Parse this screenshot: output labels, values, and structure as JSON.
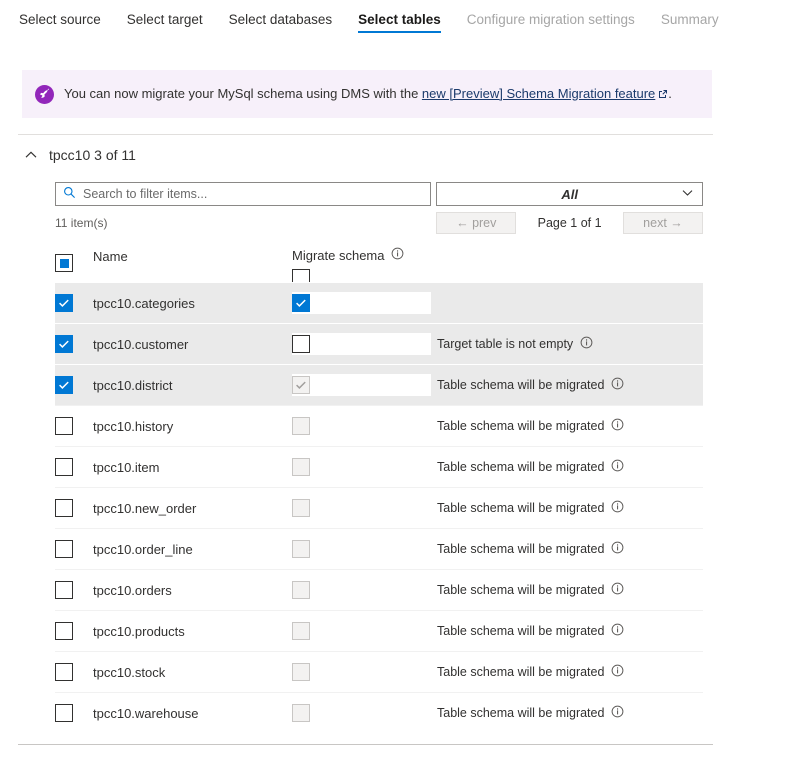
{
  "wizard": {
    "tabs": [
      {
        "label": "Select source",
        "state": "done"
      },
      {
        "label": "Select target",
        "state": "done"
      },
      {
        "label": "Select databases",
        "state": "done"
      },
      {
        "label": "Select tables",
        "state": "active"
      },
      {
        "label": "Configure migration settings",
        "state": "disabled"
      },
      {
        "label": "Summary",
        "state": "disabled"
      }
    ]
  },
  "banner": {
    "icon": "rocket-icon",
    "text_before": "You can now migrate your MySql schema using DMS with the ",
    "link_text": "new [Preview] Schema Migration feature",
    "text_after": ".",
    "background": "#f7f0fa",
    "icon_color": "#9226ba"
  },
  "section": {
    "expand_icon": "chevron-up-icon",
    "title": "tpcc10 3 of 11"
  },
  "toolbar": {
    "search": {
      "icon": "search-icon",
      "placeholder": "Search to filter items...",
      "value": ""
    },
    "filter": {
      "selected": "All",
      "icon": "chevron-down-icon"
    },
    "item_count": "11 item(s)",
    "prev_label": "← prev",
    "next_label": "next →",
    "page_label": "Page 1 of 1"
  },
  "table": {
    "header": {
      "select_all_state": "indeterminate",
      "name_label": "Name",
      "schema_label": "Migrate schema",
      "schema_info_icon": "info-icon",
      "schema_header_checkbox": "unchecked"
    },
    "rows": [
      {
        "name": "tpcc10.categories",
        "selected": true,
        "schema": "checked",
        "status": ""
      },
      {
        "name": "tpcc10.customer",
        "selected": true,
        "schema": "unchecked",
        "status": "Target table is not empty"
      },
      {
        "name": "tpcc10.district",
        "selected": true,
        "schema": "disabled-checked",
        "status": "Table schema will be migrated"
      },
      {
        "name": "tpcc10.history",
        "selected": false,
        "schema": "disabled-empty",
        "status": "Table schema will be migrated"
      },
      {
        "name": "tpcc10.item",
        "selected": false,
        "schema": "disabled-empty",
        "status": "Table schema will be migrated"
      },
      {
        "name": "tpcc10.new_order",
        "selected": false,
        "schema": "disabled-empty",
        "status": "Table schema will be migrated"
      },
      {
        "name": "tpcc10.order_line",
        "selected": false,
        "schema": "disabled-empty",
        "status": "Table schema will be migrated"
      },
      {
        "name": "tpcc10.orders",
        "selected": false,
        "schema": "disabled-empty",
        "status": "Table schema will be migrated"
      },
      {
        "name": "tpcc10.products",
        "selected": false,
        "schema": "disabled-empty",
        "status": "Table schema will be migrated"
      },
      {
        "name": "tpcc10.stock",
        "selected": false,
        "schema": "disabled-empty",
        "status": "Table schema will be migrated"
      },
      {
        "name": "tpcc10.warehouse",
        "selected": false,
        "schema": "disabled-empty",
        "status": "Table schema will be migrated"
      }
    ],
    "status_info_icon": "info-icon"
  },
  "colors": {
    "accent": "#0078d4",
    "selected_row": "#eaeaea",
    "banner_bg": "#f7f0fa"
  }
}
